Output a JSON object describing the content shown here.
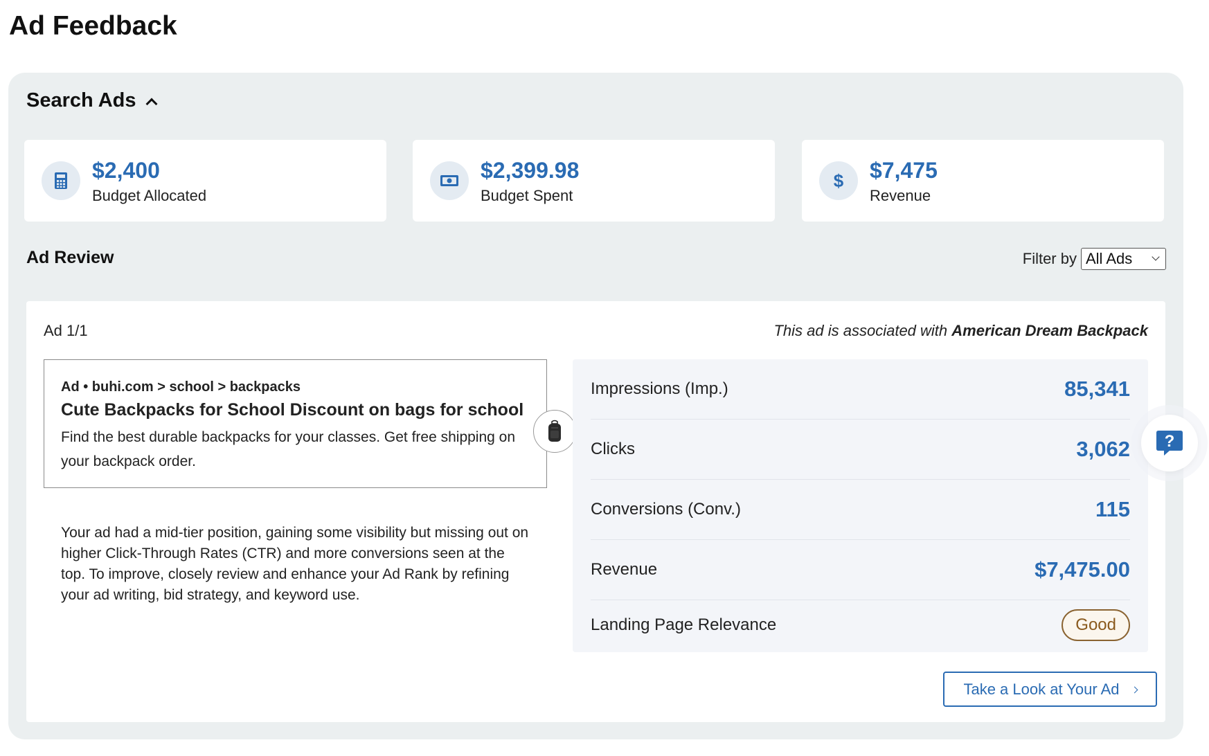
{
  "page": {
    "title": "Ad Feedback"
  },
  "section": {
    "title": "Search Ads"
  },
  "stats": [
    {
      "value": "$2,400",
      "label": "Budget Allocated",
      "icon": "calculator-icon"
    },
    {
      "value": "$2,399.98",
      "label": "Budget Spent",
      "icon": "banknote-icon"
    },
    {
      "value": "$7,475",
      "label": "Revenue",
      "icon": "dollar-icon"
    }
  ],
  "ad_review": {
    "title": "Ad Review",
    "filter_label": "Filter by",
    "filter_value": "All Ads"
  },
  "ad": {
    "count": "Ad 1/1",
    "assoc_prefix": "This ad is associated with",
    "assoc_product": "American Dream Backpack",
    "url_line": "Ad • buhi.com > school > backpacks",
    "headline": "Cute Backpacks for School Discount on bags for school",
    "description": "Find the best durable backpacks for your classes. Get free shipping on your backpack order.",
    "insight": "Your ad had a mid-tier position, gaining some visibility but missing out on higher Click-Through Rates (CTR) and more conversions seen at the top. To improve, closely review and enhance your Ad Rank by refining your ad writing, bid strategy, and keyword use."
  },
  "metrics": [
    {
      "label": "Impressions (Imp.)",
      "value": "85,341"
    },
    {
      "label": "Clicks",
      "value": "3,062"
    },
    {
      "label": "Conversions (Conv.)",
      "value": "115"
    },
    {
      "label": "Revenue",
      "value": "$7,475.00"
    },
    {
      "label": "Landing Page Relevance",
      "value": "Good"
    }
  ],
  "cta": {
    "label": "Take a Look at Your Ad"
  },
  "colors": {
    "accent": "#2a6bb3",
    "panel": "#ebeff0",
    "badge_good": "#8a6331"
  }
}
